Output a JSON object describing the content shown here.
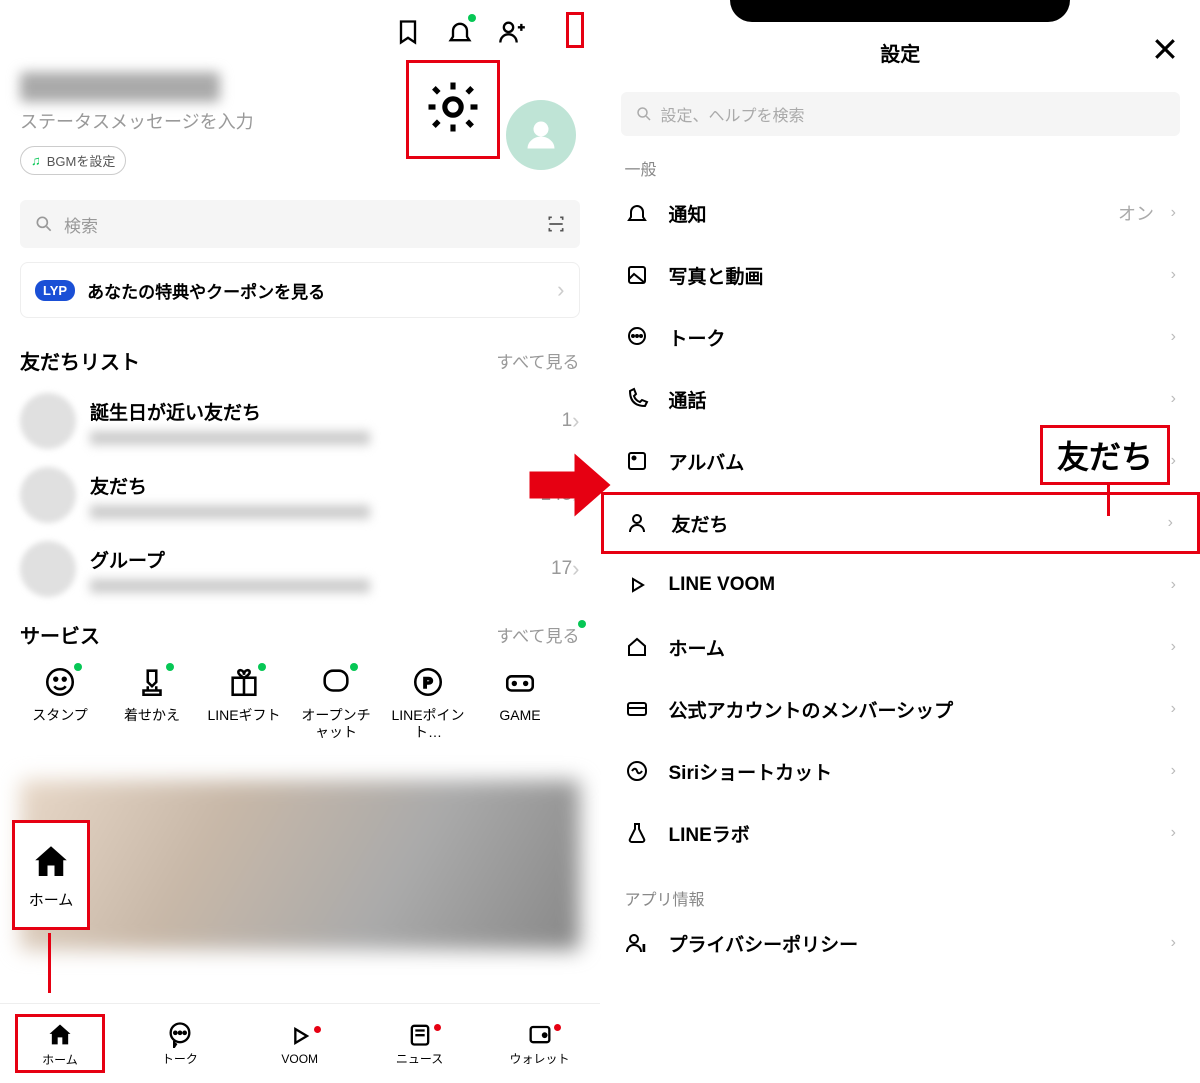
{
  "left": {
    "status_placeholder": "ステータスメッセージを入力",
    "bgm_chip": "BGMを設定",
    "search_placeholder": "検索",
    "lyp_badge": "LYP",
    "lyp_text": "あなたの特典やクーポンを見る",
    "friends": {
      "title": "友だちリスト",
      "see_all": "すべて見る",
      "rows": [
        {
          "name": "誕生日が近い友だち",
          "count": "1"
        },
        {
          "name": "友だち",
          "count": "145"
        },
        {
          "name": "グループ",
          "count": "17"
        }
      ]
    },
    "services": {
      "title": "サービス",
      "see_all": "すべて見る",
      "items": [
        {
          "label": "スタンプ"
        },
        {
          "label": "着せかえ"
        },
        {
          "label": "LINEギフト"
        },
        {
          "label": "オープンチャット"
        },
        {
          "label": "LINEポイント…"
        },
        {
          "label": "GAME"
        }
      ]
    },
    "home_float": "ホーム",
    "tabs": [
      {
        "label": "ホーム"
      },
      {
        "label": "トーク"
      },
      {
        "label": "VOOM"
      },
      {
        "label": "ニュース"
      },
      {
        "label": "ウォレット"
      }
    ]
  },
  "right": {
    "title": "設定",
    "search_placeholder": "設定、ヘルプを検索",
    "section_general": "一般",
    "rows": [
      {
        "label": "通知",
        "value": "オン"
      },
      {
        "label": "写真と動画"
      },
      {
        "label": "トーク"
      },
      {
        "label": "通話"
      },
      {
        "label": "アルバム"
      },
      {
        "label": "友だち"
      },
      {
        "label": "LINE VOOM"
      },
      {
        "label": "ホーム"
      },
      {
        "label": "公式アカウントのメンバーシップ"
      },
      {
        "label": "Siriショートカット"
      },
      {
        "label": "LINEラボ"
      }
    ],
    "section_app": "アプリ情報",
    "rows_app": [
      {
        "label": "プライバシーポリシー"
      }
    ],
    "callout": "友だち"
  }
}
